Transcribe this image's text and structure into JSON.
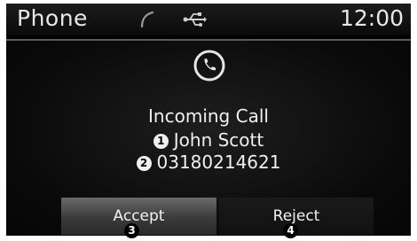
{
  "statusbar": {
    "title": "Phone",
    "clock": "12:00",
    "icons": [
      "phone-handset-icon",
      "usb-icon"
    ]
  },
  "call": {
    "icon": "phone-call-icon",
    "title": "Incoming Call",
    "caller_name": "John Scott",
    "caller_number": "03180214621"
  },
  "buttons": {
    "accept_label": "Accept",
    "reject_label": "Reject"
  },
  "callouts": {
    "name": "1",
    "number": "2",
    "accept": "3",
    "reject": "4"
  }
}
